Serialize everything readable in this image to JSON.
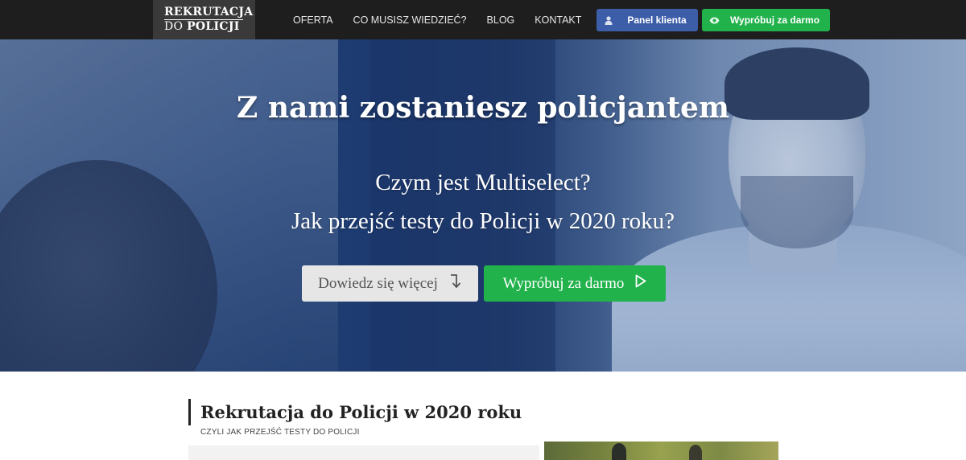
{
  "logo": {
    "line1": "REKRUTACJA",
    "line2_prefix": "DO ",
    "line2_bold": "POLICJI"
  },
  "nav": {
    "items": [
      "OFERTA",
      "CO MUSISZ WIEDZIEĆ?",
      "BLOG",
      "KONTAKT"
    ]
  },
  "header_buttons": {
    "panel_label": "Panel klienta",
    "try_label": "Wypróbuj za darmo"
  },
  "hero": {
    "title": "Z nami zostaniesz policjantem",
    "subtitle_line1": "Czym jest Multiselect?",
    "subtitle_line2": "Jak przejść testy do Policji w 2020 roku?",
    "more_button": "Dowiedz się więcej",
    "try_button": "Wypróbuj za darmo"
  },
  "section": {
    "title": "Rekrutacja do Policji w 2020 roku",
    "subtitle": "CZYLI JAK PRZEJŚĆ TESTY DO POLICJI"
  },
  "icons": {
    "panel": "user-icon",
    "try_top": "eye-icon",
    "more": "arrow-down-turn-icon",
    "try_hero": "play-triangle-icon"
  },
  "colors": {
    "navbar": "#1e1e1e",
    "logo_bg": "#3a3a3a",
    "panel_button": "#3c5da8",
    "green": "#22b24c",
    "hero_overlay": "#1d3a6f",
    "light_button": "#e6e6e6"
  }
}
